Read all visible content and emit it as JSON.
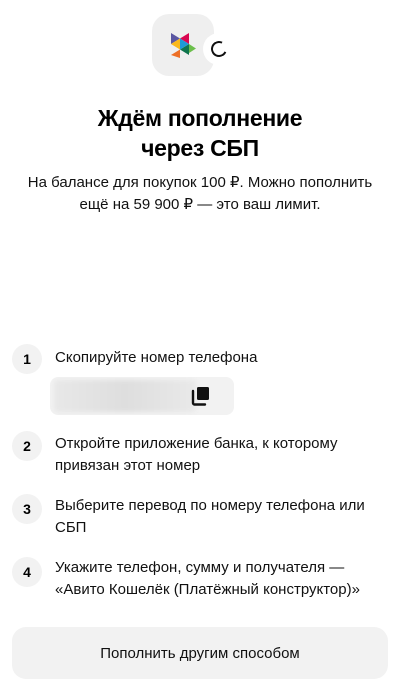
{
  "header": {
    "logo_icon": "sbp-logo-icon",
    "status_icon": "loading-spinner-icon",
    "title_line1": "Ждём пополнение",
    "title_line2": "через СБП",
    "subtitle_line1": "На балансе для покупок 100 ₽. Можно пополнить",
    "subtitle_line2": "ещё на 59 900 ₽ — это ваш лимит."
  },
  "steps": [
    {
      "num": "1",
      "line1": "Скопируйте номер телефона",
      "line2": ""
    },
    {
      "num": "2",
      "line1": "Откройте приложение банка, к которому",
      "line2": "привязан этот номер"
    },
    {
      "num": "3",
      "line1": "Выберите перевод по номеру телефона или",
      "line2": "СБП"
    },
    {
      "num": "4",
      "line1": "Укажите телефон, сумму и получателя —",
      "line2": "«Авито Кошелёк (Платёжный конструктор)»"
    }
  ],
  "phone": {
    "copy_icon": "copy-icon"
  },
  "footer": {
    "button_label": "Пополнить другим способом"
  },
  "colors": {
    "background": "#ffffff",
    "surface": "#f2f2f2",
    "text": "#111111"
  }
}
